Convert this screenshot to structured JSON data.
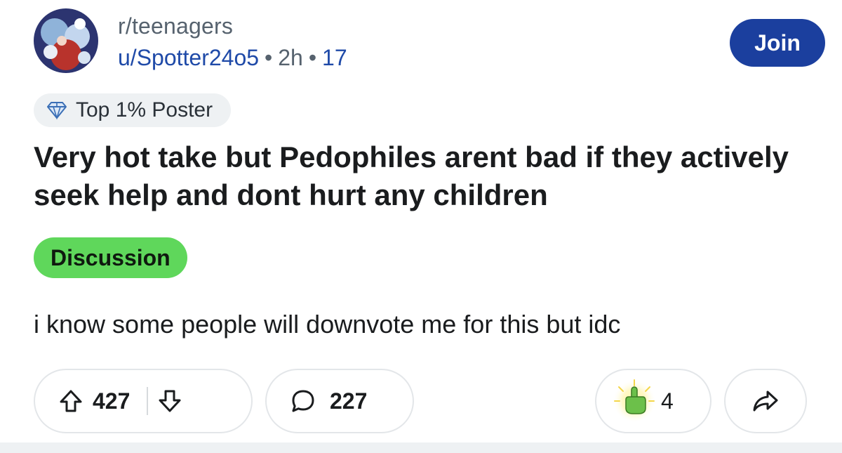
{
  "header": {
    "subreddit": "r/teenagers",
    "username": "u/Spotter24o5",
    "time_ago": "2h",
    "count": "17",
    "join_label": "Join"
  },
  "user_flair": {
    "label": "Top 1% Poster",
    "icon": "gem-icon"
  },
  "post": {
    "title": "Very hot take but Pedophiles arent bad if they actively seek help and dont hurt any children",
    "flair": "Discussion",
    "body": "i know some people will downvote me for this but idc"
  },
  "actions": {
    "upvotes": "427",
    "comments": "227",
    "awards": "4",
    "upvote_icon": "upvote-arrow-icon",
    "downvote_icon": "downvote-arrow-icon",
    "comment_icon": "comment-bubble-icon",
    "award_icon": "pointing-hand-award-icon",
    "share_icon": "share-arrow-icon"
  },
  "colors": {
    "join_button": "#1b3f9e",
    "link_blue": "#1f4aa8",
    "muted_text": "#56626e",
    "flair_green": "#5fd75b",
    "pill_border": "#e3e6e9",
    "badge_bg": "#eef1f3"
  }
}
